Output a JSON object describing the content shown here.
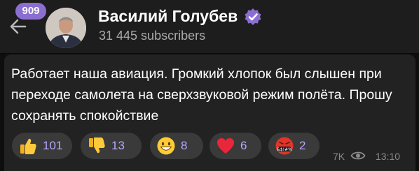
{
  "header": {
    "unread_count": "909",
    "channel_name": "Василий Голубев",
    "subscribers": "31 445 subscribers",
    "back_icon": "arrow-left-icon",
    "verified_icon": "verified-badge-icon"
  },
  "message": {
    "text": "Работает наша авиация. Громкий хлопок был слышен при переходе самолета на сверхзвуковой режим полёта. Прошу сохранять спокойствие",
    "views": "7K",
    "time": "13:10"
  },
  "reactions": [
    {
      "emoji": "thumbs-up",
      "count": "101"
    },
    {
      "emoji": "thumbs-down",
      "count": "13"
    },
    {
      "emoji": "grinning-face",
      "count": "8"
    },
    {
      "emoji": "red-heart",
      "count": "6"
    },
    {
      "emoji": "face-with-symbols-on-mouth",
      "count": "2"
    }
  ],
  "colors": {
    "background": "#0e0e0e",
    "header": "#1d1d1d",
    "bubble": "#222222",
    "accent": "#8a6fd1",
    "reaction_count": "#b9a6ff"
  }
}
